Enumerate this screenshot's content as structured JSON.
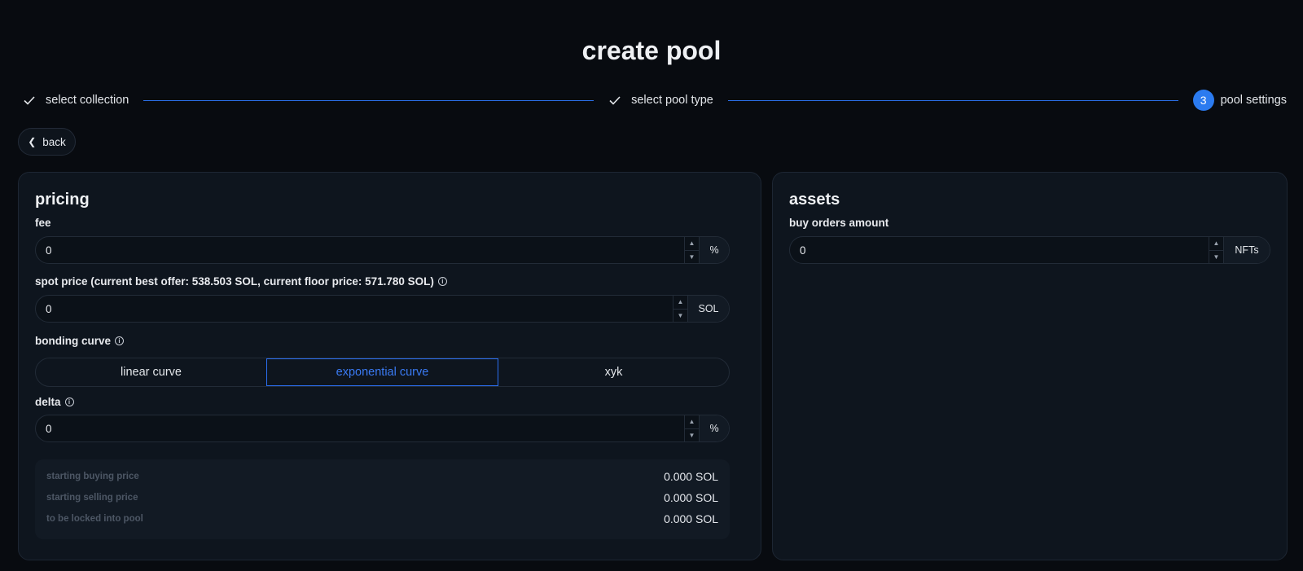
{
  "page_title": "create pool",
  "stepper": {
    "steps": [
      {
        "label": "select collection",
        "state": "done"
      },
      {
        "label": "select pool type",
        "state": "done"
      },
      {
        "label": "pool settings",
        "state": "current",
        "number": "3"
      }
    ]
  },
  "back_label": "back",
  "pricing": {
    "title": "pricing",
    "fee": {
      "label": "fee",
      "value": "0",
      "unit": "%"
    },
    "spot_price": {
      "label": "spot price (current best offer: 538.503 SOL, current floor price: 571.780 SOL)",
      "value": "0",
      "unit": "SOL"
    },
    "bonding_curve": {
      "label": "bonding curve",
      "options": [
        "linear curve",
        "exponential curve",
        "xyk"
      ],
      "selected": "exponential curve"
    },
    "delta": {
      "label": "delta",
      "value": "0",
      "unit": "%"
    },
    "summary": [
      {
        "label": "starting buying price",
        "value": "0.000 SOL"
      },
      {
        "label": "starting selling price",
        "value": "0.000 SOL"
      },
      {
        "label": "to be locked into pool",
        "value": "0.000 SOL"
      }
    ]
  },
  "assets": {
    "title": "assets",
    "buy_orders": {
      "label": "buy orders amount",
      "value": "0",
      "unit": "NFTs"
    }
  },
  "colors": {
    "accent": "#2b7bf0",
    "background": "#080b10",
    "panel": "#0e151e"
  }
}
